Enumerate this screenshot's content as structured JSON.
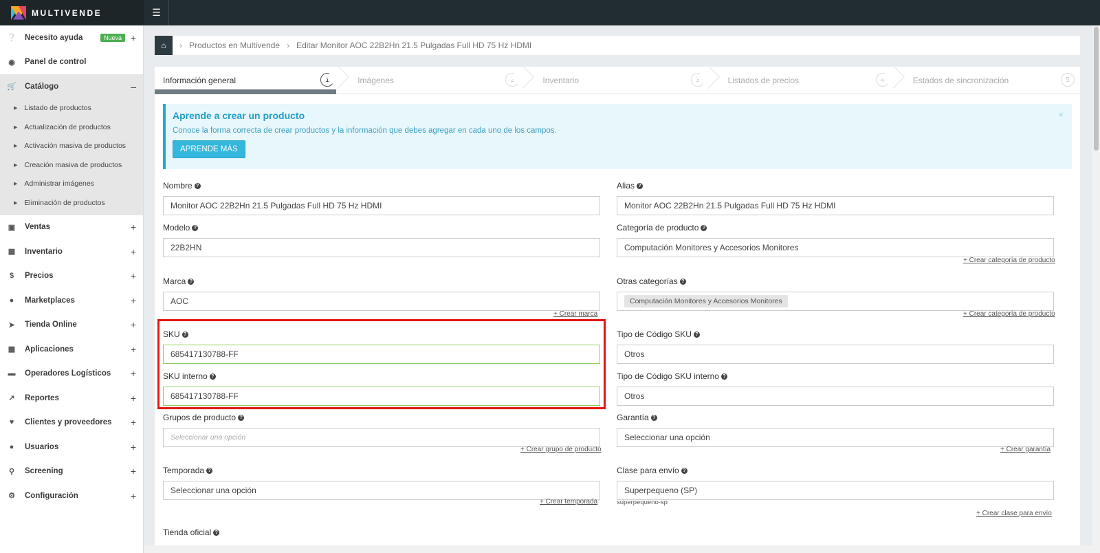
{
  "app": {
    "name": "MULTIVENDE"
  },
  "sidebar": {
    "items": [
      {
        "label": "Necesito ayuda",
        "badge": "Nueva",
        "icon": "question-circle-icon"
      },
      {
        "label": "Panel de control",
        "icon": "dashboard-icon"
      },
      {
        "label": "Catálogo",
        "icon": "cart-icon"
      },
      {
        "label": "Ventas",
        "icon": "money-icon"
      },
      {
        "label": "Inventario",
        "icon": "cubes-icon"
      },
      {
        "label": "Precios",
        "icon": "dollar-icon"
      },
      {
        "label": "Marketplaces",
        "icon": "globe-icon"
      },
      {
        "label": "Tienda Online",
        "icon": "pointer-icon"
      },
      {
        "label": "Aplicaciones",
        "icon": "puzzle-icon"
      },
      {
        "label": "Operadores Logísticos",
        "icon": "truck-icon"
      },
      {
        "label": "Reportes",
        "icon": "chart-icon"
      },
      {
        "label": "Clientes y proveedores",
        "icon": "heart-icon"
      },
      {
        "label": "Usuarios",
        "icon": "user-icon"
      },
      {
        "label": "Screening",
        "icon": "search-icon"
      },
      {
        "label": "Configuración",
        "icon": "gear-icon"
      }
    ],
    "catalog_sub": [
      "Listado de productos",
      "Actualización de productos",
      "Activación masiva de productos",
      "Creación masiva de productos",
      "Administrar imágenes",
      "Eliminación de productos"
    ]
  },
  "breadcrumb": {
    "items": [
      "Productos en Multivende",
      "Editar Monitor AOC 22B2Hn 21.5 Pulgadas Full HD 75 Hz HDMI"
    ]
  },
  "tabs": [
    {
      "label": "Información general",
      "num": "1"
    },
    {
      "label": "Imágenes",
      "num": "2"
    },
    {
      "label": "Inventario",
      "num": "3"
    },
    {
      "label": "Listados de precios",
      "num": "4"
    },
    {
      "label": "Estados de sincronización",
      "num": "5"
    }
  ],
  "info": {
    "title": "Aprende a crear un producto",
    "text": "Conoce la forma correcta de crear productos y la información que debes agregar en cada uno de los campos.",
    "button": "APRENDE MÁS",
    "close": "×"
  },
  "form": {
    "nombre": {
      "label": "Nombre",
      "value": "Monitor AOC 22B2Hn 21.5 Pulgadas Full HD 75 Hz HDMI"
    },
    "alias": {
      "label": "Alias",
      "value": "Monitor AOC 22B2Hn 21.5 Pulgadas Full HD 75 Hz HDMI"
    },
    "modelo": {
      "label": "Modelo",
      "value": "22B2HN"
    },
    "categoria": {
      "label": "Categoría de producto",
      "value": "Computación Monitores y Accesorios Monitores",
      "link": "+ Crear categoría de producto"
    },
    "marca": {
      "label": "Marca",
      "value": "AOC",
      "link": "+ Crear marca"
    },
    "otras_categorias": {
      "label": "Otras categorías",
      "chip": "Computación Monitores y Accesorios Monitores",
      "link": "+ Crear categoría de producto"
    },
    "sku": {
      "label": "SKU",
      "value": "685417130788-FF"
    },
    "tipo_sku": {
      "label": "Tipo de Código SKU",
      "value": "Otros"
    },
    "sku_interno": {
      "label": "SKU interno",
      "value": "685417130788-FF"
    },
    "tipo_sku_interno": {
      "label": "Tipo de Código SKU interno",
      "value": "Otros"
    },
    "grupos": {
      "label": "Grupos de producto",
      "placeholder": "Seleccionar una opción",
      "link": "+ Crear grupo de producto"
    },
    "garantia": {
      "label": "Garantía",
      "value": "Seleccionar una opción",
      "link": "+ Crear garantía"
    },
    "temporada": {
      "label": "Temporada",
      "value": "Seleccionar una opción",
      "link": "+ Crear temporada"
    },
    "clase_envio": {
      "label": "Clase para envío",
      "value": "Superpequeno (SP)",
      "hint": "superpequeno-sp",
      "link": "+ Crear clase para envío"
    },
    "tienda_oficial": {
      "label": "Tienda oficial"
    }
  }
}
